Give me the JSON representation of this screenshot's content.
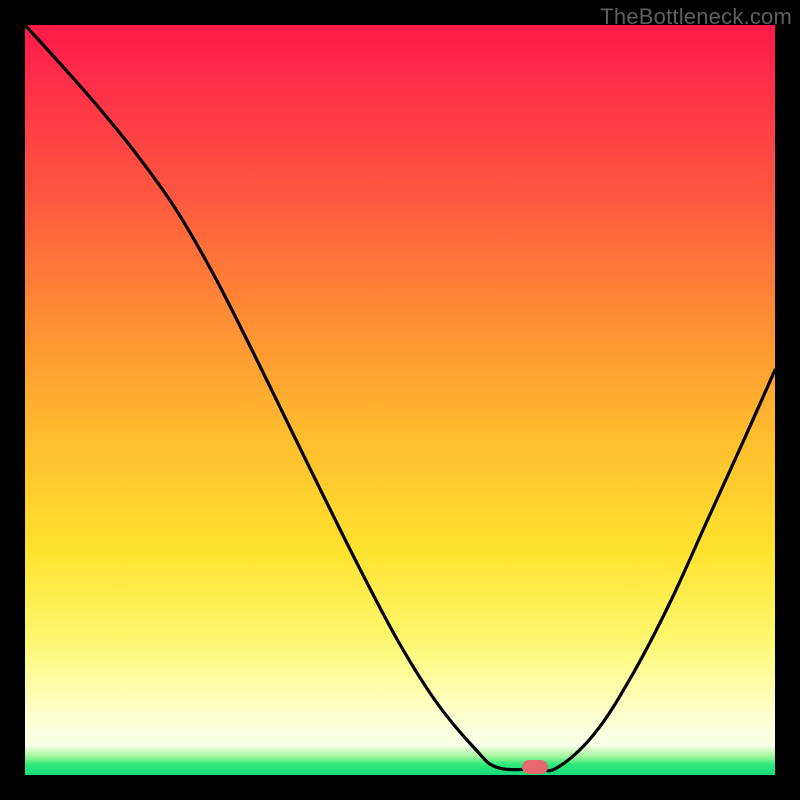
{
  "watermark": "TheBottleneck.com",
  "plot": {
    "inner_width": 750,
    "inner_height": 750,
    "margin": 25
  },
  "marker": {
    "x_frac": 0.68,
    "y_frac": 0.989,
    "color": "#e46a6f"
  },
  "chart_data": {
    "type": "line",
    "title": "",
    "xlabel": "",
    "ylabel": "",
    "xlim": [
      0,
      1
    ],
    "ylim": [
      0,
      1
    ],
    "note": "Axes are unlabeled; values are normalized 0..1 where y is measured from the top (0) to bottom (1) of the plot area, matching the rendered curve. The curve has an asymmetric V shape reaching its minimum (y≈0.99) near x≈0.63–0.71.",
    "series": [
      {
        "name": "bottleneck-curve",
        "x": [
          0.0,
          0.05,
          0.1,
          0.15,
          0.2,
          0.25,
          0.3,
          0.35,
          0.4,
          0.45,
          0.5,
          0.55,
          0.6,
          0.63,
          0.68,
          0.71,
          0.76,
          0.81,
          0.86,
          0.91,
          0.96,
          1.0
        ],
        "y_top": [
          0.0,
          0.055,
          0.112,
          0.174,
          0.244,
          0.33,
          0.428,
          0.53,
          0.632,
          0.732,
          0.826,
          0.905,
          0.965,
          0.99,
          0.992,
          0.99,
          0.944,
          0.866,
          0.77,
          0.66,
          0.55,
          0.46
        ]
      }
    ]
  }
}
